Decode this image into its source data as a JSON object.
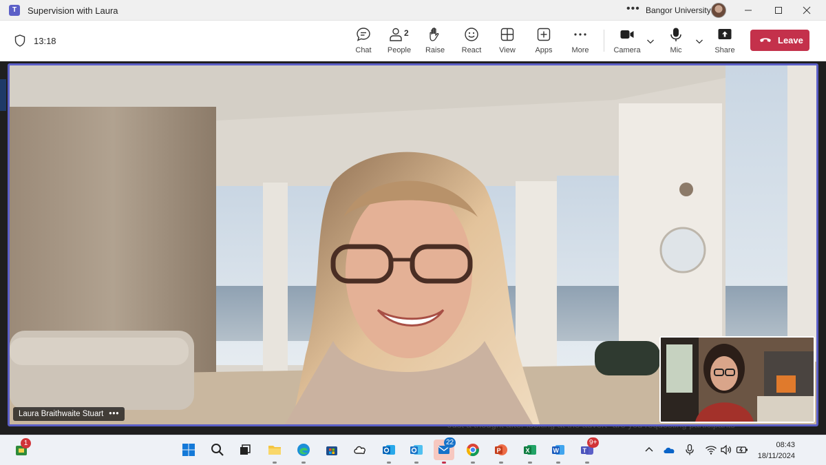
{
  "window": {
    "title": "Supervision with Laura",
    "organization": "Bangor University",
    "more_glyph": "•••",
    "controls": [
      "minimize",
      "maximize",
      "close"
    ]
  },
  "meeting": {
    "elapsed": "13:18",
    "toolbar": {
      "chat": "Chat",
      "people": "People",
      "people_count": "2",
      "raise": "Raise",
      "react": "React",
      "view": "View",
      "apps": "Apps",
      "more": "More",
      "camera": "Camera",
      "mic": "Mic",
      "share": "Share",
      "leave": "Leave"
    },
    "participant_name": "Laura Braithwaite Stuart",
    "name_more": "•••",
    "background_text": "Just a thought after looking at the advert- are you requesting participants"
  },
  "taskbar": {
    "start_badge": "1",
    "mail_badge": "22",
    "teams_badge": "9+",
    "time": "08:43",
    "date": "18/11/2024"
  },
  "colors": {
    "accent": "#5b5fc7",
    "leave": "#c4314b",
    "taskbar": "#eef1f6"
  }
}
